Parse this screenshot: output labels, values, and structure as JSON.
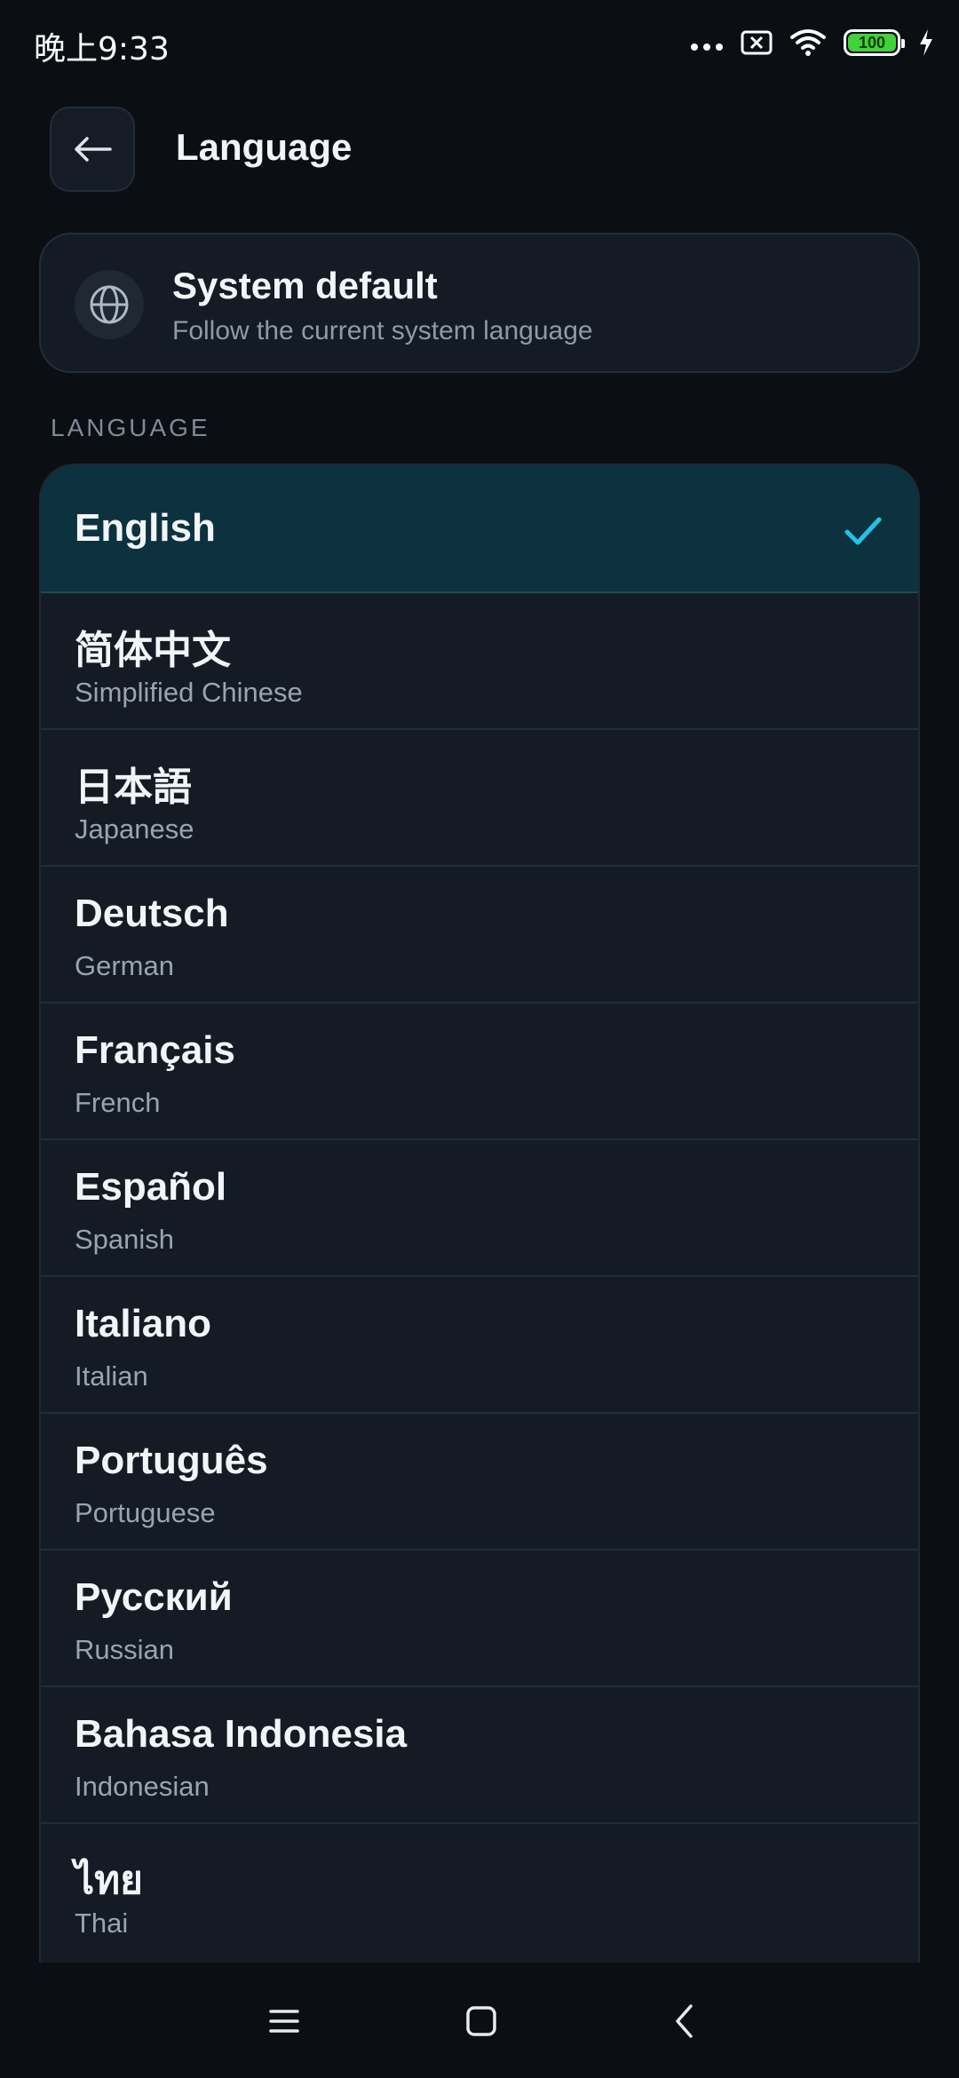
{
  "status_bar": {
    "time": "晚上9:33",
    "battery": "100"
  },
  "header": {
    "title": "Language"
  },
  "system_default": {
    "title": "System default",
    "subtitle": "Follow the current system language"
  },
  "section_label": "LANGUAGE",
  "languages": [
    {
      "native": "English",
      "english": "",
      "selected": true
    },
    {
      "native": "简体中文",
      "english": "Simplified Chinese",
      "selected": false
    },
    {
      "native": "日本語",
      "english": "Japanese",
      "selected": false
    },
    {
      "native": "Deutsch",
      "english": "German",
      "selected": false
    },
    {
      "native": "Français",
      "english": "French",
      "selected": false
    },
    {
      "native": "Español",
      "english": "Spanish",
      "selected": false
    },
    {
      "native": "Italiano",
      "english": "Italian",
      "selected": false
    },
    {
      "native": "Português",
      "english": "Portuguese",
      "selected": false
    },
    {
      "native": "Русский",
      "english": "Russian",
      "selected": false
    },
    {
      "native": "Bahasa Indonesia",
      "english": "Indonesian",
      "selected": false
    },
    {
      "native": "ไทย",
      "english": "Thai",
      "selected": false
    }
  ],
  "colors": {
    "background": "#0b0f14",
    "card": "#141b24",
    "selected_row": "#0c323f",
    "accent_check": "#22c3e6",
    "battery_green": "#43d13a"
  }
}
